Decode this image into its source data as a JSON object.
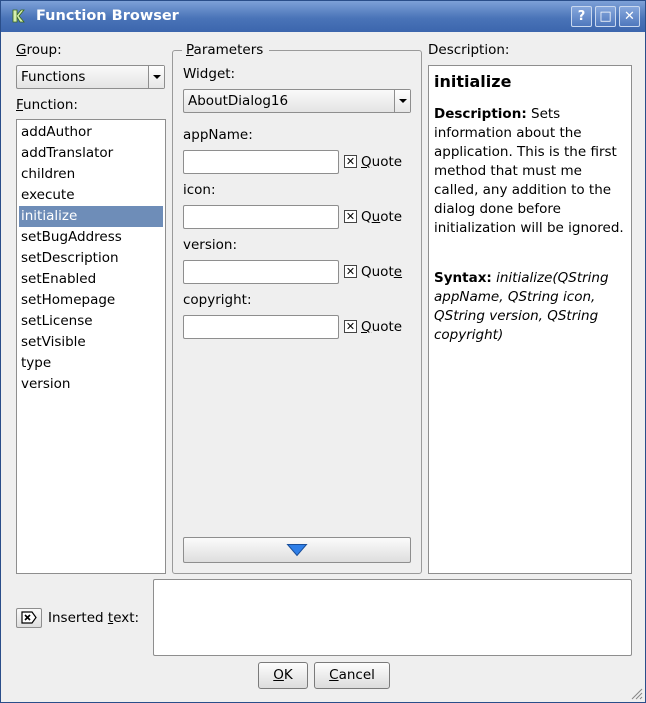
{
  "window": {
    "title": "Function Browser"
  },
  "titlebar_buttons": {
    "help": "?",
    "maximize": "□",
    "close": "✕"
  },
  "group": {
    "label_u": "G",
    "label_rest": "roup:",
    "value": "Functions"
  },
  "function": {
    "label_u": "F",
    "label_rest": "unction:",
    "items": [
      "addAuthor",
      "addTranslator",
      "children",
      "execute",
      "initialize",
      "setBugAddress",
      "setDescription",
      "setEnabled",
      "setHomepage",
      "setLicense",
      "setVisible",
      "type",
      "version"
    ],
    "selected": "initialize"
  },
  "parameters": {
    "title_u": "P",
    "title_rest": "arameters",
    "widget_label": "Widget:",
    "widget_value": "AboutDialog16",
    "fields": [
      {
        "label": "appName:",
        "value": "",
        "quote_pre": "",
        "quote_u": "Q",
        "quote_post": "uote",
        "checked": true
      },
      {
        "label": "icon:",
        "value": "",
        "quote_pre": "Q",
        "quote_u": "u",
        "quote_post": "ote",
        "checked": true
      },
      {
        "label": "version:",
        "value": "",
        "quote_pre": "Quot",
        "quote_u": "e",
        "quote_post": "",
        "checked": true
      },
      {
        "label": "copyright:",
        "value": "",
        "quote_pre": "",
        "quote_u": "Q",
        "quote_post": "uote",
        "checked": true
      }
    ]
  },
  "description": {
    "label": "Description:",
    "name": "initialize",
    "desc_head": "Description:",
    "desc_text": "Sets information about the application. This is the first method that must me called, any addition to the dialog done before initialization will be ignored.",
    "syntax_head": "Syntax:",
    "syntax_text": "initialize(QString appName, QString icon, QString version, QString copyright)"
  },
  "inserted": {
    "label_pre": "Inserted ",
    "label_u": "t",
    "label_post": "ext:",
    "value": ""
  },
  "buttons": {
    "ok_u": "O",
    "ok_rest": "K",
    "cancel_u": "C",
    "cancel_rest": "ancel"
  },
  "colors": {
    "titlebar": "#4a74b8",
    "selection": "#6e8db8",
    "arrow_blue": "#2f7fe8"
  }
}
